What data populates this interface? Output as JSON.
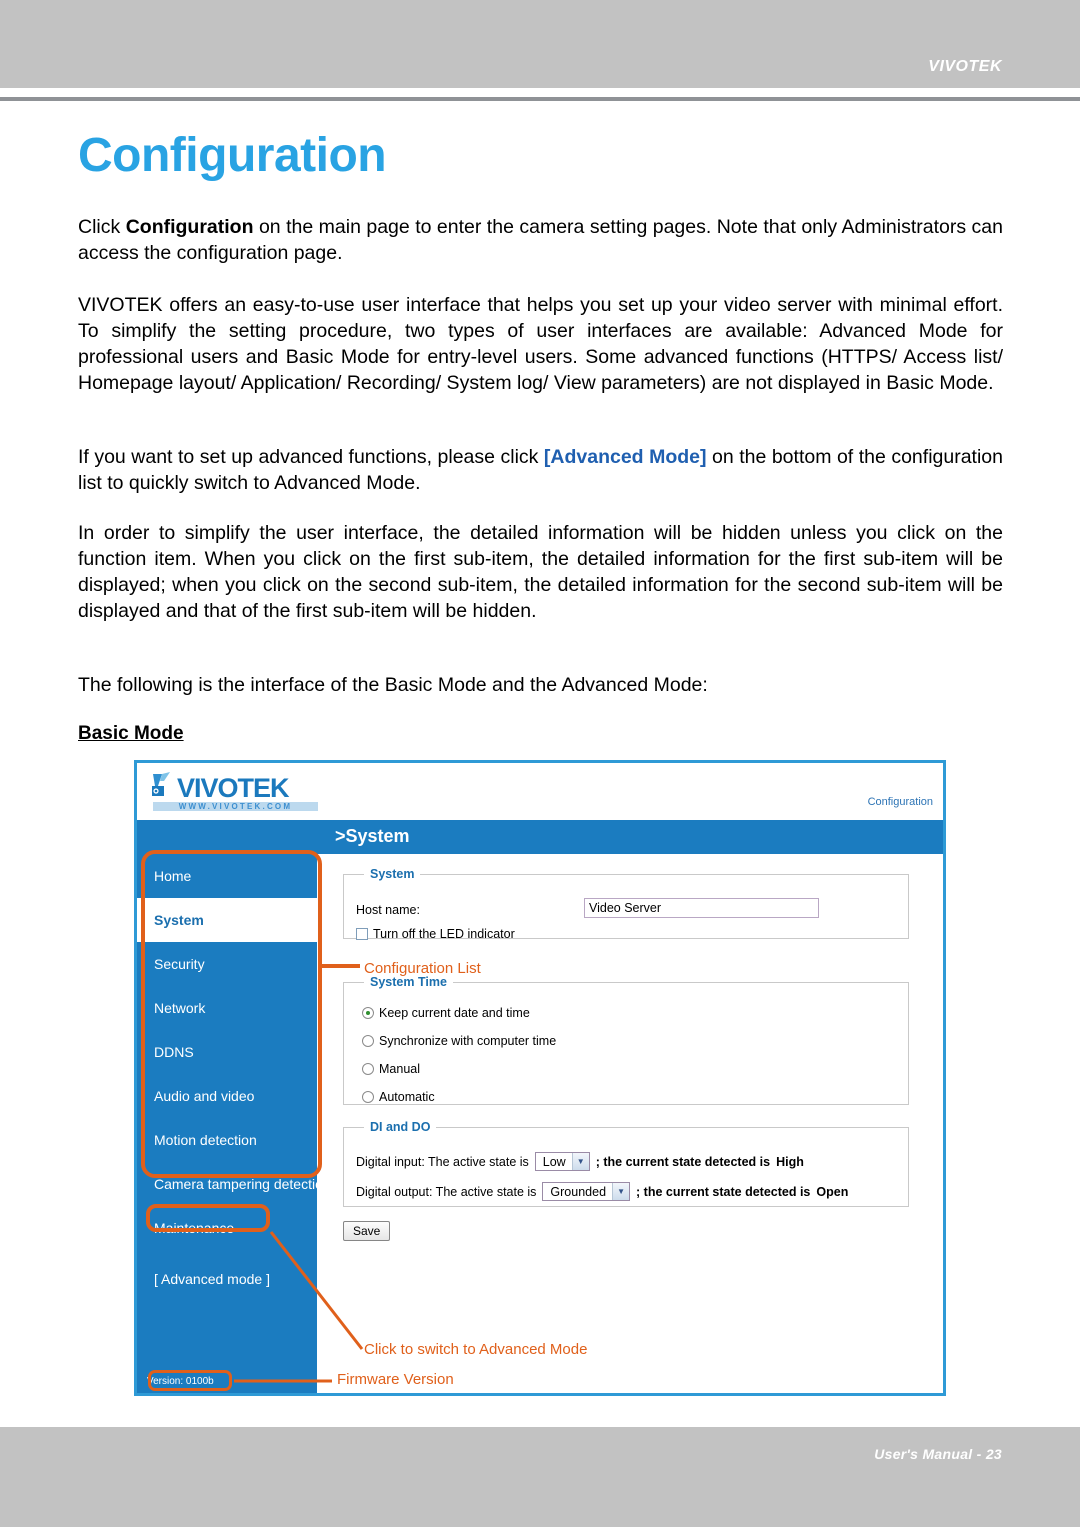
{
  "page": {
    "brand": "VIVOTEK",
    "footer": "User's Manual - 23",
    "title": "Configuration"
  },
  "body": {
    "p1_pre": "Click ",
    "p1_bold": "Configuration",
    "p1_post": " on the main page to enter the camera setting pages. Note that only Administrators can access the configuration page.",
    "p2": "VIVOTEK offers an easy-to-use user interface that helps you set up your video server with minimal effort. To simplify the setting procedure, two types of user interfaces are available: Advanced Mode for professional users and Basic Mode for entry-level users. Some advanced functions (HTTPS/ Access list/ Homepage layout/ Application/ Recording/ System log/ View parameters) are not displayed in Basic Mode.",
    "p3_pre": "If you want to set up advanced functions, please click ",
    "p3_link": "[Advanced Mode]",
    "p3_post": " on the bottom of the configuration list to quickly switch to Advanced Mode.",
    "p4": "In order to simplify the user interface, the detailed information will be hidden unless you click on the function item. When you click on the first sub-item, the detailed information for the first sub-item will be displayed; when you click on the second sub-item, the detailed information for the second sub-item will be displayed and that of the first sub-item will be hidden.",
    "p5": "The following is the interface of the Basic Mode and the Advanced Mode:",
    "section_label": "Basic Mode"
  },
  "screenshot": {
    "logo_word": "VIVOTEK",
    "logo_url": "WWW.VIVOTEK.COM",
    "config_link": "Configuration",
    "page_title": ">System",
    "nav": {
      "items": [
        {
          "label": "Home",
          "active": false
        },
        {
          "label": "System",
          "active": true
        },
        {
          "label": "Security",
          "active": false
        },
        {
          "label": "Network",
          "active": false
        },
        {
          "label": "DDNS",
          "active": false
        },
        {
          "label": "Audio and video",
          "active": false
        },
        {
          "label": "Motion detection",
          "active": false
        },
        {
          "label": "Camera tampering detection",
          "active": false
        },
        {
          "label": "Maintenance",
          "active": false
        }
      ],
      "advanced_mode": "[ Advanced mode ]",
      "version": "Version: 0100b"
    },
    "system_panel": {
      "legend": "System",
      "hostname_label": "Host name:",
      "hostname_value": "Video Server",
      "led_checkbox_label": "Turn off the LED indicator"
    },
    "system_time_panel": {
      "legend": "System Time",
      "options": [
        {
          "label": "Keep current date and time",
          "selected": true
        },
        {
          "label": "Synchronize with computer time",
          "selected": false
        },
        {
          "label": "Manual",
          "selected": false
        },
        {
          "label": "Automatic",
          "selected": false
        }
      ]
    },
    "dido_panel": {
      "legend": "DI and DO",
      "di_prefix": "Digital input: The active state is",
      "di_value": "Low",
      "di_mid": "; the current state detected is",
      "di_state": "High",
      "do_prefix": "Digital output: The active state is",
      "do_value": "Grounded",
      "do_mid": "; the current state detected is",
      "do_state": "Open"
    },
    "save_button": "Save"
  },
  "annotations": {
    "configuration_list": "Configuration List",
    "switch_advanced": "Click to switch to Advanced Mode",
    "firmware_version": "Firmware Version",
    "color": "#e0601b"
  }
}
